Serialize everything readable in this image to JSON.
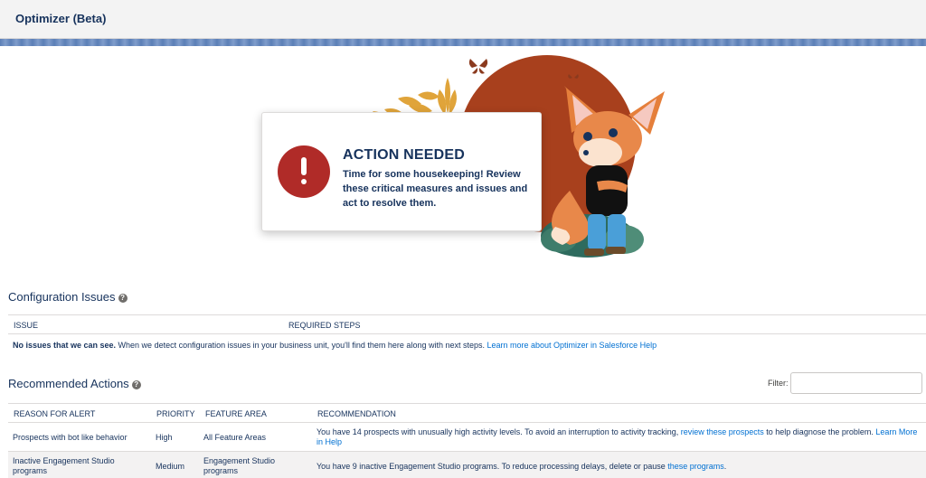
{
  "app": {
    "title": "Optimizer (Beta)"
  },
  "alert": {
    "title": "ACTION NEEDED",
    "message": "Time for some housekeeping! Review these critical measures and issues and act to resolve them."
  },
  "config_issues": {
    "heading": "Configuration Issues",
    "columns": [
      "ISSUE",
      "REQUIRED STEPS"
    ],
    "empty_bold": "No issues that we can see.",
    "empty_text": " When we detect configuration issues in your business unit, you'll find them here along with next steps. ",
    "help_link": "Learn more about Optimizer in Salesforce Help"
  },
  "recommended": {
    "heading": "Recommended Actions",
    "filter_label": "Filter:",
    "filter_value": "",
    "columns": [
      "REASON FOR ALERT",
      "PRIORITY",
      "FEATURE AREA",
      "RECOMMENDATION"
    ],
    "rows": [
      {
        "reason": "Prospects with bot like behavior",
        "priority": "High",
        "feature_area": "All Feature Areas",
        "rec_text": "You have 14 prospects with unusually high activity levels. To avoid an interruption to activity tracking, ",
        "rec_link": "review these prospects",
        "rec_text_after": " to help diagnose the problem. ",
        "rec_link2": "Learn More in Help"
      },
      {
        "reason": "Inactive Engagement Studio programs",
        "priority": "Medium",
        "feature_area": "Engagement Studio programs",
        "rec_text": "You have 9 inactive Engagement Studio programs. To reduce processing delays, delete or pause ",
        "rec_link": "these programs",
        "rec_text_after": "."
      }
    ]
  },
  "icons": [
    "help-icon",
    "alert-exclamation-icon",
    "butterfly-icon",
    "fox-mascot-illustration"
  ],
  "colors": {
    "alert_red": "#b02b28",
    "circle_orange": "#a8401d",
    "link_blue": "#0070d2",
    "text_navy": "#16325c"
  }
}
